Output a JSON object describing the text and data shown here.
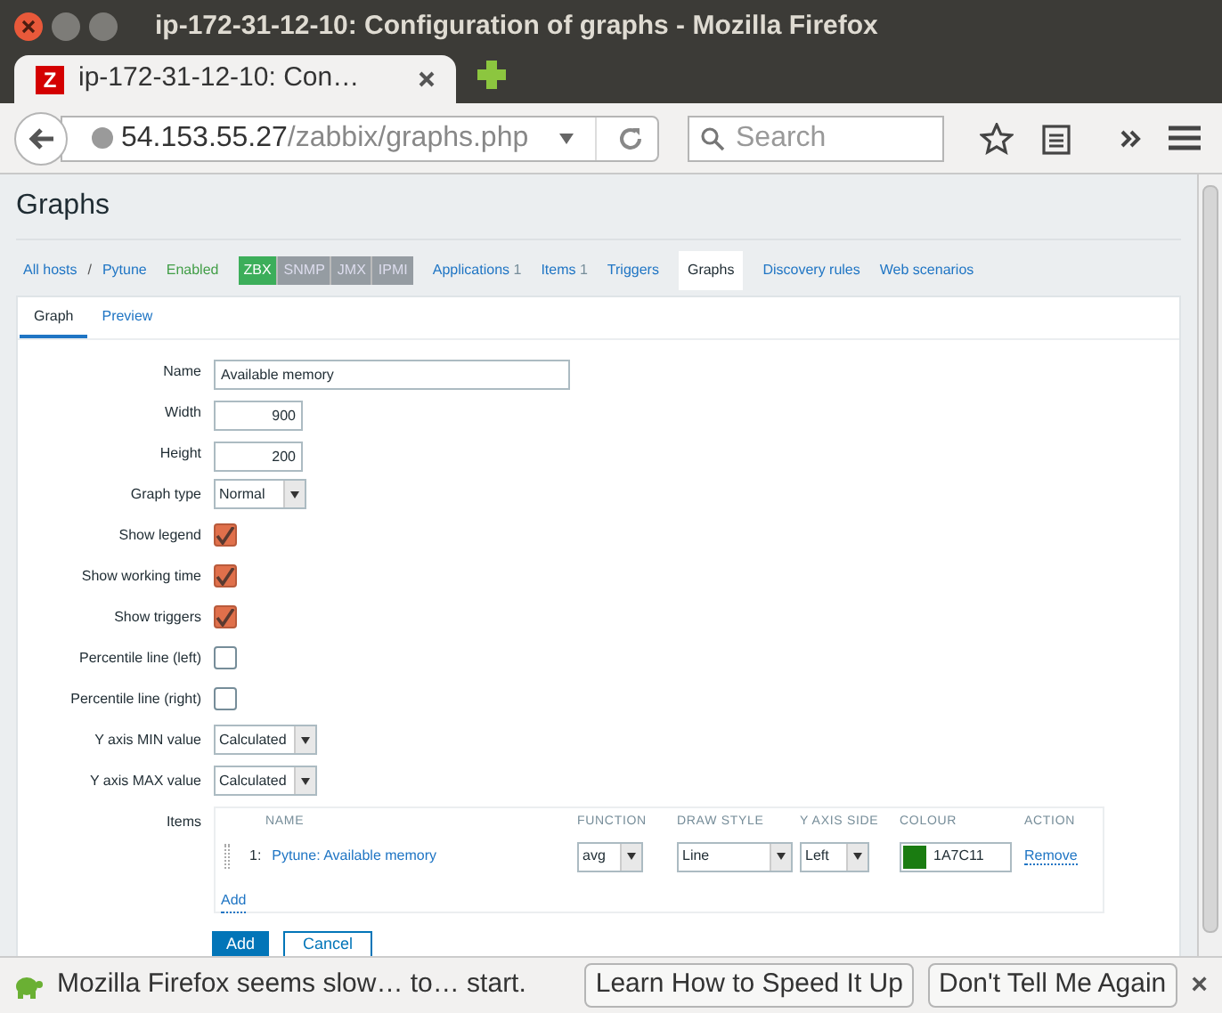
{
  "window": {
    "title": "ip-172-31-12-10: Configuration of graphs - Mozilla Firefox"
  },
  "tabs": [
    {
      "label": "ip-172-31-12-10: Con…",
      "favicon": "Z",
      "selected": true
    }
  ],
  "toolbar": {
    "url_host": "54.153.55.27",
    "url_path": "/zabbix/graphs.php",
    "search_placeholder": "Search"
  },
  "page": {
    "title": "Graphs",
    "breadcrumbs": [
      {
        "label": "All hosts",
        "kind": "link"
      },
      {
        "label": "/",
        "kind": "separator"
      },
      {
        "label": "Pytune",
        "kind": "link"
      },
      {
        "label": "Enabled",
        "kind": "status"
      }
    ],
    "availability": [
      {
        "label": "ZBX",
        "active": true
      },
      {
        "label": "SNMP",
        "active": false
      },
      {
        "label": "JMX",
        "active": false
      },
      {
        "label": "IPMI",
        "active": false
      }
    ],
    "host_nav": [
      {
        "label": "Applications",
        "count": "1",
        "selected": false
      },
      {
        "label": "Items",
        "count": "1",
        "selected": false
      },
      {
        "label": "Triggers",
        "selected": false
      },
      {
        "label": "Graphs",
        "selected": true
      },
      {
        "label": "Discovery rules",
        "selected": false
      },
      {
        "label": "Web scenarios",
        "selected": false
      }
    ],
    "form_tabs": [
      {
        "label": "Graph",
        "selected": true
      },
      {
        "label": "Preview",
        "selected": false
      }
    ],
    "fields": [
      {
        "label": "Name",
        "kind": "text",
        "value": "Available memory"
      },
      {
        "label": "Width",
        "kind": "number",
        "value": "900"
      },
      {
        "label": "Height",
        "kind": "number",
        "value": "200"
      },
      {
        "label": "Graph type",
        "kind": "select",
        "value": "Normal"
      },
      {
        "label": "Show legend",
        "kind": "checkbox",
        "checked": true
      },
      {
        "label": "Show working time",
        "kind": "checkbox",
        "checked": true
      },
      {
        "label": "Show triggers",
        "kind": "checkbox",
        "checked": true
      },
      {
        "label": "Percentile line (left)",
        "kind": "checkbox",
        "checked": false
      },
      {
        "label": "Percentile line (right)",
        "kind": "checkbox",
        "checked": false
      },
      {
        "label": "Y axis MIN value",
        "kind": "select",
        "value": "Calculated"
      },
      {
        "label": "Y axis MAX value",
        "kind": "select",
        "value": "Calculated"
      }
    ],
    "items": {
      "label": "Items",
      "columns": [
        "NAME",
        "FUNCTION",
        "DRAW STYLE",
        "Y AXIS SIDE",
        "COLOUR",
        "ACTION"
      ],
      "rows": [
        {
          "index": "1:",
          "name": "Pytune: Available memory",
          "function": "avg",
          "draw_style": "Line",
          "y_axis_side": "Left",
          "colour": "1A7C11",
          "color": "#1a7c11",
          "action": "Remove"
        }
      ],
      "add_link": "Add"
    },
    "buttons": [
      {
        "label": "Add",
        "kind": "primary"
      },
      {
        "label": "Cancel",
        "kind": "secondary"
      }
    ]
  },
  "notification": {
    "message": "Mozilla Firefox seems slow… to… start.",
    "buttons": [
      "Learn How to Speed It Up",
      "Don't Tell Me Again"
    ],
    "close": "×"
  }
}
